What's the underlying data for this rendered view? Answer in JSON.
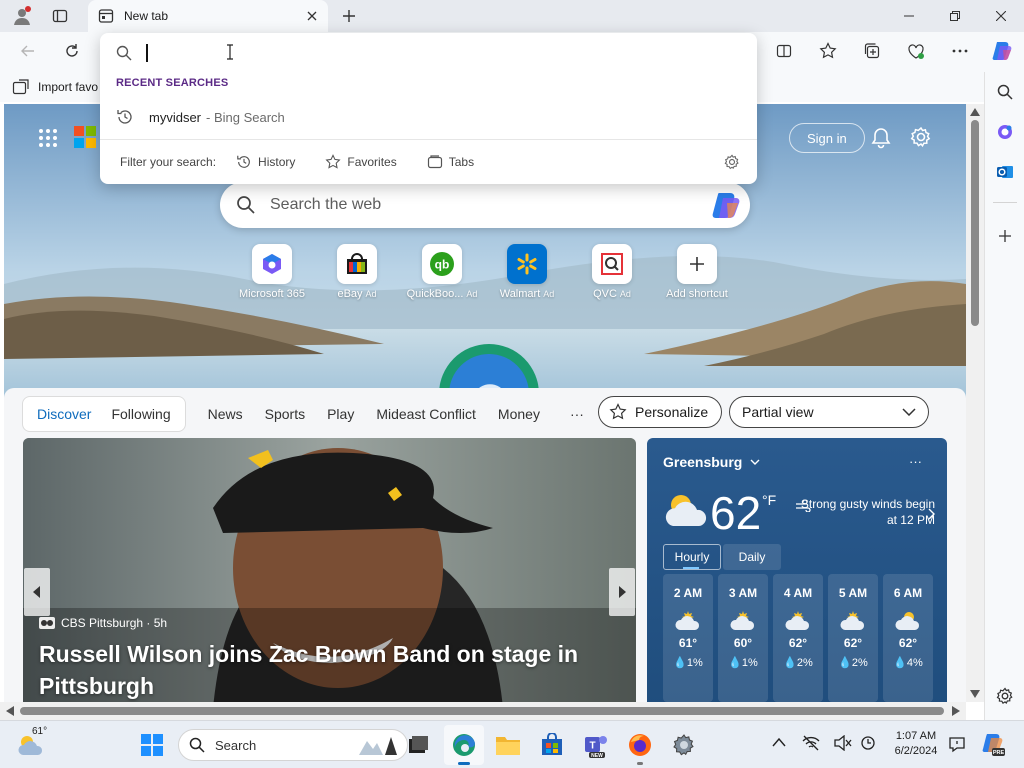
{
  "browser": {
    "tab_title": "New tab",
    "address_placeholder": "",
    "favorites_bar": {
      "import_label": "Import favo"
    }
  },
  "dropdown": {
    "recent_heading": "RECENT SEARCHES",
    "recent_item": {
      "query": "myvidser",
      "source": "- Bing Search"
    },
    "filter_label": "Filter your search:",
    "filters": [
      "History",
      "Favorites",
      "Tabs"
    ]
  },
  "newtab": {
    "sign_in": "Sign in",
    "search_placeholder": "Search the web",
    "shortcuts": [
      {
        "label": "Microsoft 365",
        "ad": ""
      },
      {
        "label": "eBay",
        "ad": "Ad"
      },
      {
        "label": "QuickBoo...",
        "ad": "Ad"
      },
      {
        "label": "Walmart",
        "ad": "Ad"
      },
      {
        "label": "QVC",
        "ad": "Ad"
      },
      {
        "label": "Add shortcut",
        "ad": ""
      }
    ]
  },
  "feed": {
    "tabs": [
      "Discover",
      "Following"
    ],
    "nav": [
      "News",
      "Sports",
      "Play",
      "Mideast Conflict",
      "Money"
    ],
    "more": "···",
    "personalize": "Personalize",
    "view_select": "Partial view",
    "article": {
      "source": "CBS Pittsburgh · 5h",
      "headline": "Russell Wilson joins Zac Brown Band on stage in Pittsburgh"
    }
  },
  "weather": {
    "city": "Greensburg",
    "temp": "62",
    "unit": "°F",
    "condition": "Strong gusty winds begin at 12 PM",
    "tabs": [
      "Hourly",
      "Daily"
    ],
    "hourly": [
      {
        "time": "2 AM",
        "temp": "61°",
        "precip": "1%"
      },
      {
        "time": "3 AM",
        "temp": "60°",
        "precip": "1%"
      },
      {
        "time": "4 AM",
        "temp": "62°",
        "precip": "2%"
      },
      {
        "time": "5 AM",
        "temp": "62°",
        "precip": "2%"
      },
      {
        "time": "6 AM",
        "temp": "62°",
        "precip": "4%"
      }
    ],
    "more": "···"
  },
  "taskbar": {
    "weather_temp": "61°",
    "search_label": "Search",
    "time": "1:07 AM",
    "date": "6/2/2024"
  }
}
